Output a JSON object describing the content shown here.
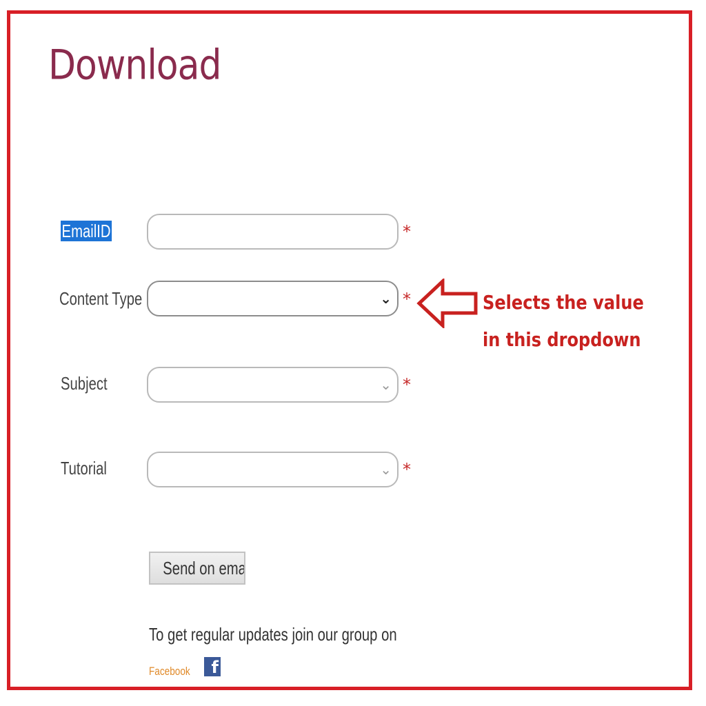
{
  "page": {
    "title": "Download"
  },
  "form": {
    "email": {
      "label": "EmailID",
      "value": ""
    },
    "content_type": {
      "label": "Content Type",
      "value": ""
    },
    "subject": {
      "label": "Subject",
      "value": ""
    },
    "tutorial": {
      "label": "Tutorial",
      "value": ""
    },
    "required_marker": "*",
    "dropdown_icon": "chevron-down-icon",
    "send_button_label": "Send on email"
  },
  "footer": {
    "updates_text": "To get regular updates join our group on",
    "facebook_label": "Facebook",
    "facebook_icon_glyph": "f"
  },
  "annotation": {
    "text": "Selects the value in this dropdown",
    "color": "#c8211f"
  },
  "colors": {
    "frame_border": "#d81f26",
    "title": "#8a2b4d",
    "selection": "#1e74d6",
    "facebook": "#3b5998",
    "link": "#e08a2a"
  }
}
